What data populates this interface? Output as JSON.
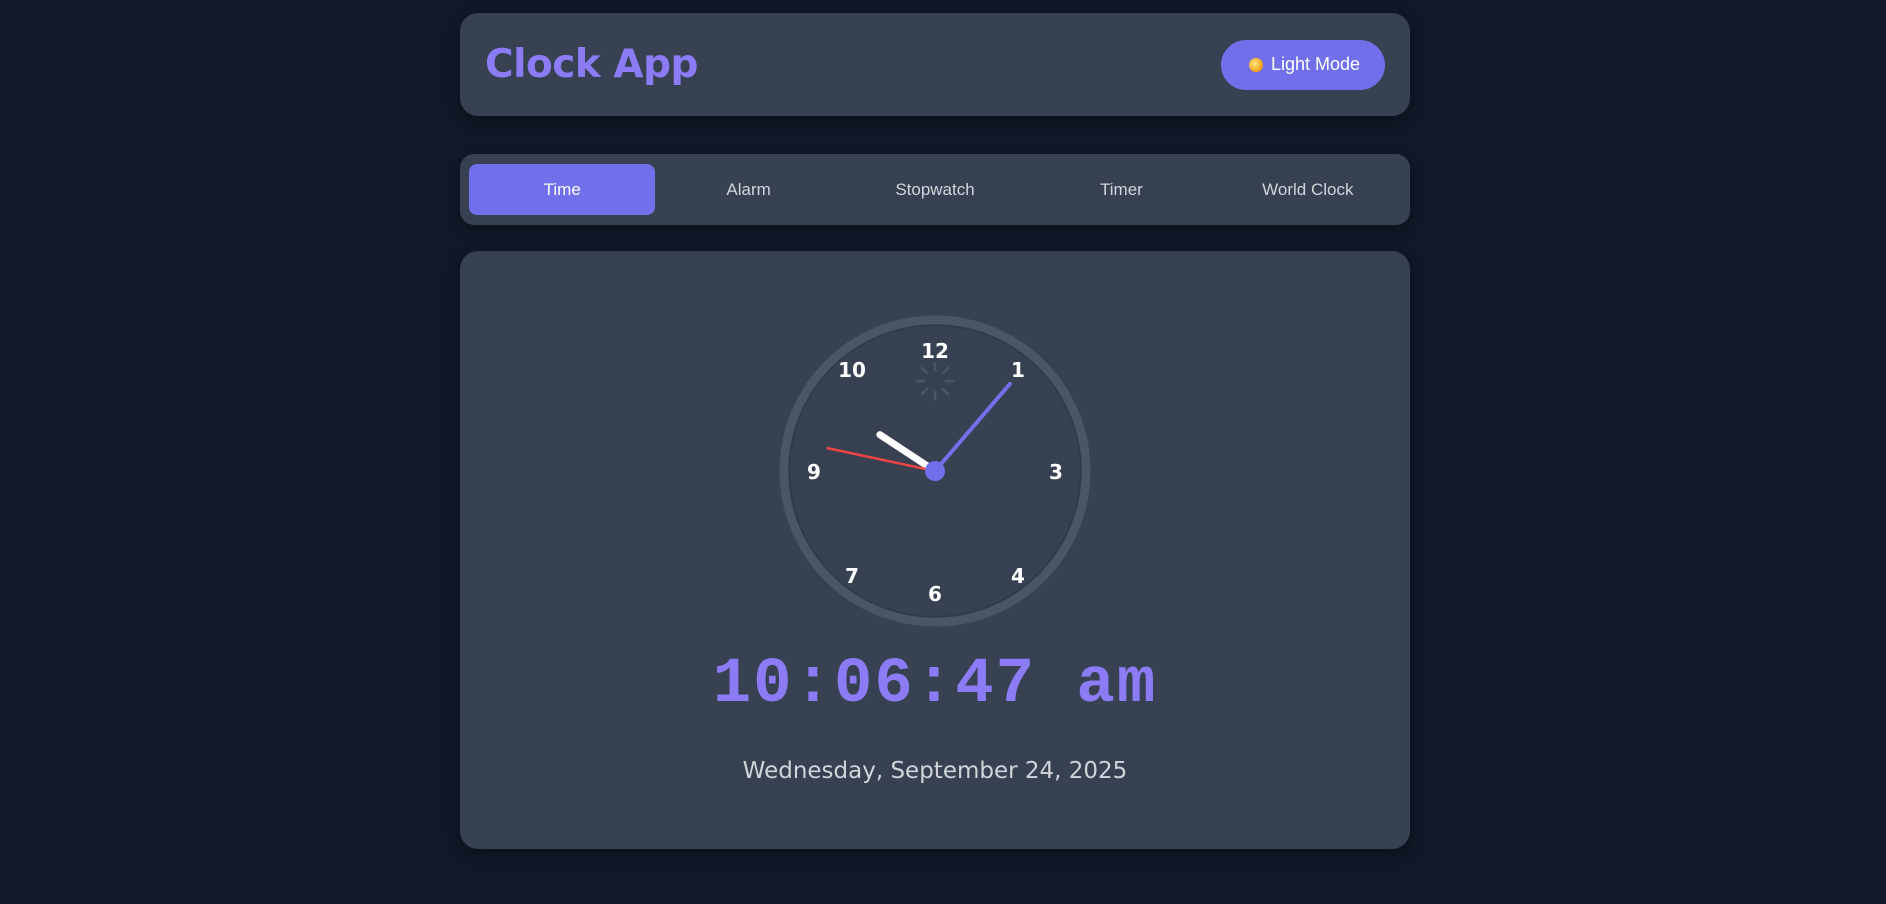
{
  "header": {
    "title": "Clock App",
    "theme_toggle_label": "Light Mode",
    "theme_toggle_icon": "sun-icon"
  },
  "tabs": [
    {
      "label": "Time",
      "active": true
    },
    {
      "label": "Alarm",
      "active": false
    },
    {
      "label": "Stopwatch",
      "active": false
    },
    {
      "label": "Timer",
      "active": false
    },
    {
      "label": "World Clock",
      "active": false
    }
  ],
  "clock": {
    "numerals": [
      "12",
      "1",
      "3",
      "4",
      "6",
      "7",
      "9",
      "10"
    ],
    "hours": 10,
    "minutes": 6,
    "seconds": 47,
    "digital_time": "10:06:47 am",
    "date": "Wednesday, September 24, 2025"
  },
  "colors": {
    "background": "#111827",
    "panel": "#374151",
    "accent": "#7170ea",
    "title": "#8b7cf6",
    "second_hand": "#ef4444",
    "hour_hand": "#ffffff"
  }
}
